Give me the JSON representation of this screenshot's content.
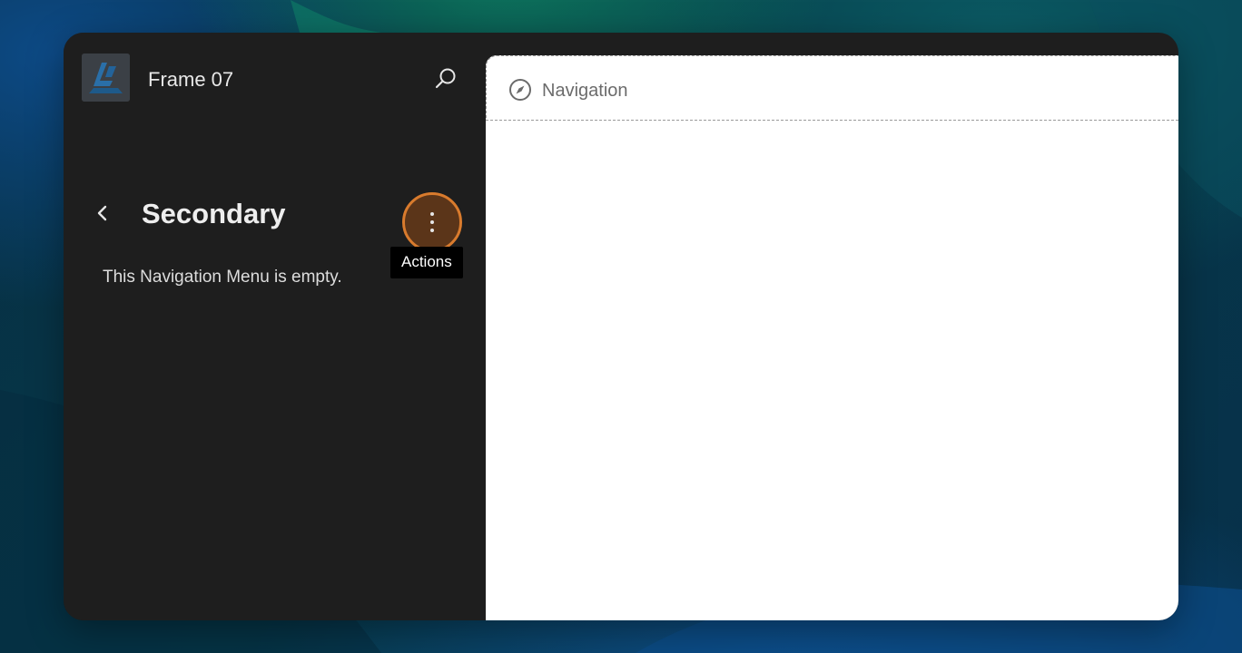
{
  "sidebar": {
    "site_title": "Frame 07",
    "section_title": "Secondary",
    "empty_message": "This Navigation Menu is empty.",
    "actions_tooltip": "Actions"
  },
  "canvas": {
    "navigation_label": "Navigation"
  },
  "icons": {
    "logo": "site-logo-icon",
    "search": "search-icon",
    "back": "chevron-left-icon",
    "actions": "more-vertical-icon",
    "navigation": "compass-icon"
  },
  "colors": {
    "sidebar_bg": "#1e1e1e",
    "canvas_bg": "#ffffff",
    "actions_highlight": "#d97b2d"
  }
}
